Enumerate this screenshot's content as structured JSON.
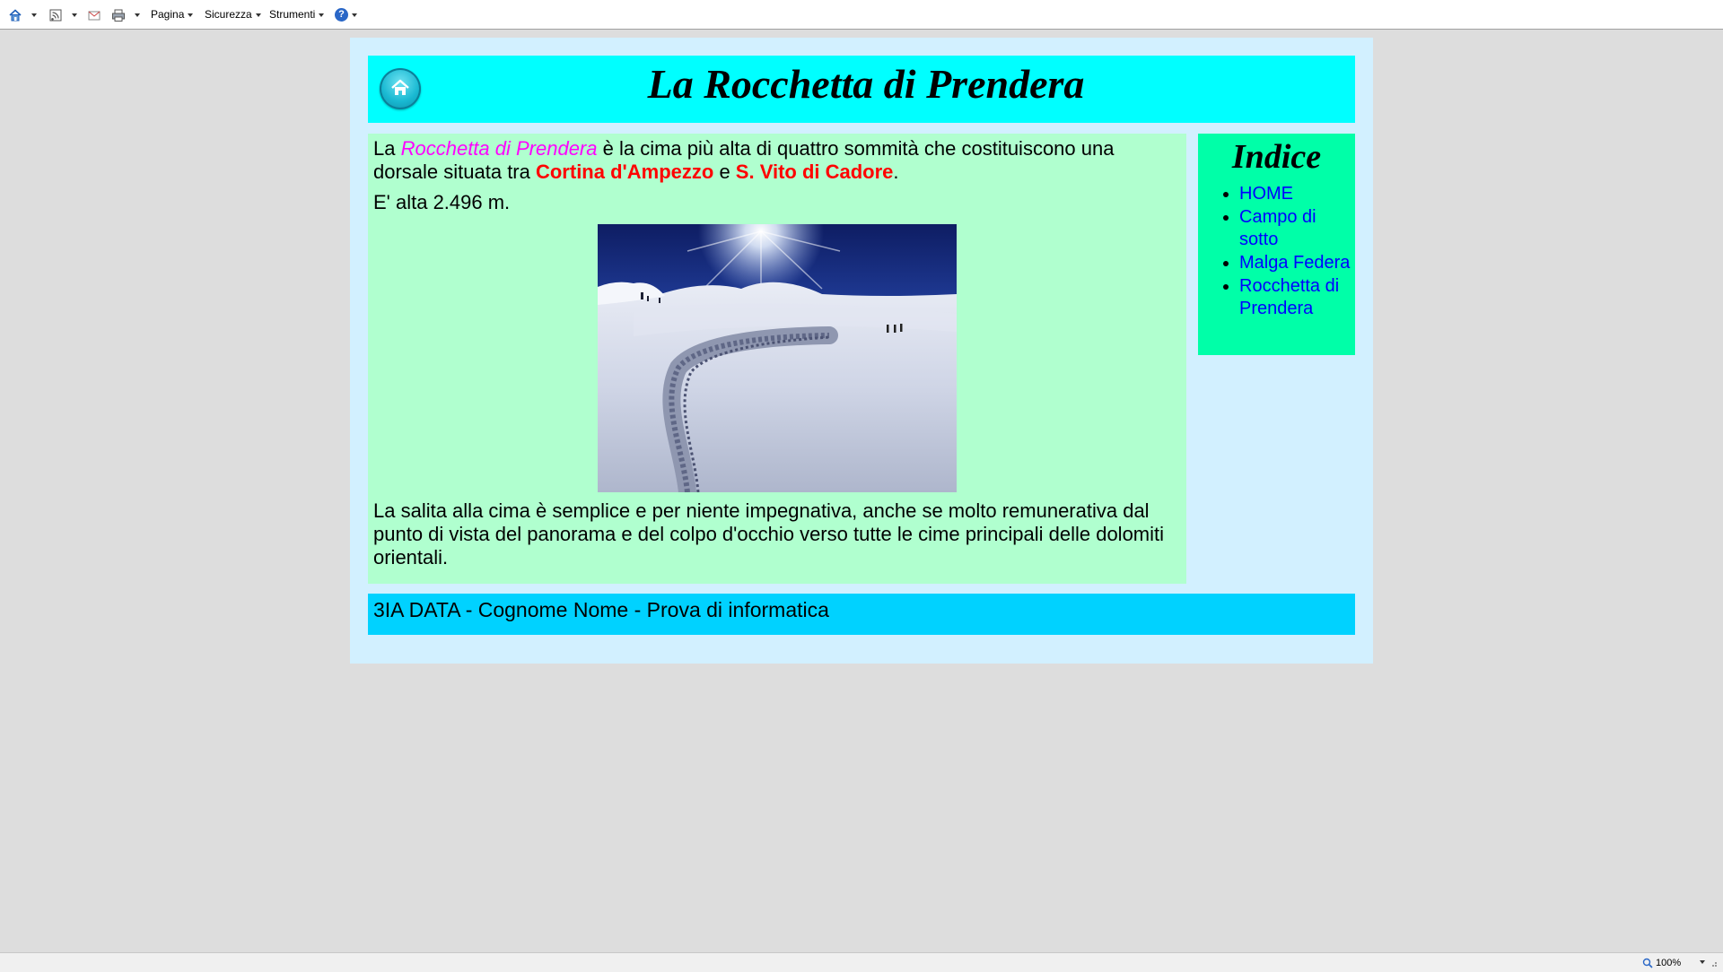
{
  "toolbar": {
    "items": [
      {
        "name": "home-icon",
        "label": ""
      },
      {
        "name": "feeds-icon",
        "label": ""
      },
      {
        "name": "mail-icon",
        "label": ""
      },
      {
        "name": "print-icon",
        "label": ""
      }
    ],
    "page_menu": "Pagina",
    "security_menu": "Sicurezza",
    "tools_menu": "Strumenti",
    "help_icon": "help-icon"
  },
  "header": {
    "title": "La Rocchetta di Prendera",
    "home_icon": "home-icon"
  },
  "content": {
    "p1_a": "La ",
    "p1_name": "Rocchetta di Prendera",
    "p1_b": " è la cima più alta di quattro sommità che costituiscono una dorsale situata tra ",
    "p1_place1": "Cortina d'Ampezzo",
    "p1_c": " e ",
    "p1_place2": "S. Vito di Cadore",
    "p1_d": ".",
    "p2": "E' alta 2.496 m.",
    "p3": "La salita alla cima è semplice e per niente impegnativa, anche se molto remunerativa dal punto di vista del panorama e del colpo d'occhio verso tutte le cime principali delle dolomiti orientali.",
    "photo": "snowfield-ski-tracks-photo"
  },
  "sidebar": {
    "title": "Indice",
    "links": [
      "HOME",
      "Campo di sotto",
      "Malga Federa",
      "Rocchetta di Prendera"
    ]
  },
  "footer": {
    "text": "3IA DATA - Cognome Nome - Prova di informatica"
  },
  "statusbar": {
    "zoom": "100%"
  },
  "colors": {
    "window_bg": "#dddddd",
    "page_bg": "#d2f0ff",
    "header_bg": "#00ffff",
    "content_bg": "#b0ffcf",
    "sidebar_bg": "#00ffa8",
    "footer_bg": "#00d2ff",
    "link": "#0000ff",
    "emphasis_magenta": "#ff00ff",
    "emphasis_red": "#ff0000"
  }
}
